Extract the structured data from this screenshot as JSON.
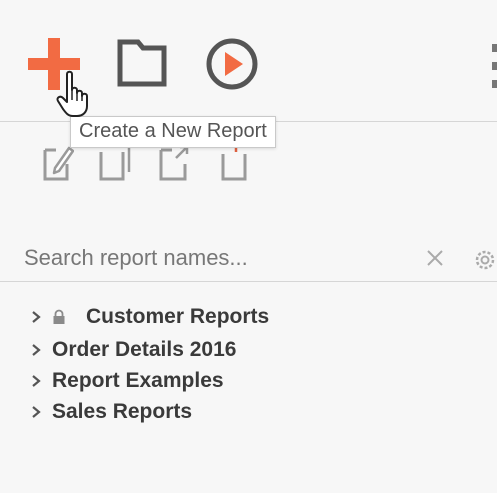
{
  "toolbar": {
    "add_icon": "plus-icon",
    "add_color": "#f26b43",
    "folder_icon": "folder-icon",
    "run_icon": "play-circle-icon",
    "run_color": "#f26b43",
    "icon_color": "#555555",
    "tooltip": "Create a New Report"
  },
  "search": {
    "placeholder": "Search report names...",
    "value": "",
    "clear_icon": "close-icon",
    "settings_icon": "gear-icon"
  },
  "tree": {
    "items": [
      {
        "label": "Customer Reports",
        "locked": true
      },
      {
        "label": "Order Details 2016",
        "locked": false
      },
      {
        "label": "Report Examples",
        "locked": false
      },
      {
        "label": "Sales Reports",
        "locked": false
      }
    ]
  }
}
